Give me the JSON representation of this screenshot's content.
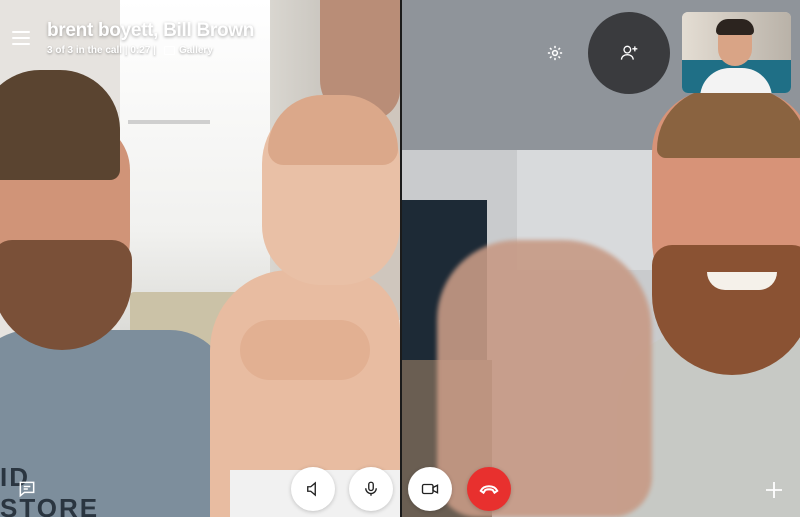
{
  "call": {
    "title": "brent boyett, Bill Brown",
    "status": "3 of 3 in the call | 0:27 |",
    "view_mode": "Gallery"
  },
  "left_video": {
    "shirt_text": "ID STORE"
  },
  "icons": {
    "menu": "hamburger-menu-icon",
    "settings": "gear-icon",
    "add_participant": "add-person-icon",
    "speaker": "speaker-icon",
    "microphone": "microphone-icon",
    "video": "video-camera-icon",
    "end_call": "hang-up-icon",
    "chat": "chat-icon",
    "more": "plus-icon"
  },
  "colors": {
    "end_call": "#e8302e",
    "control_bg": "#ffffff",
    "add_button_bg": "#3a3b3e"
  }
}
